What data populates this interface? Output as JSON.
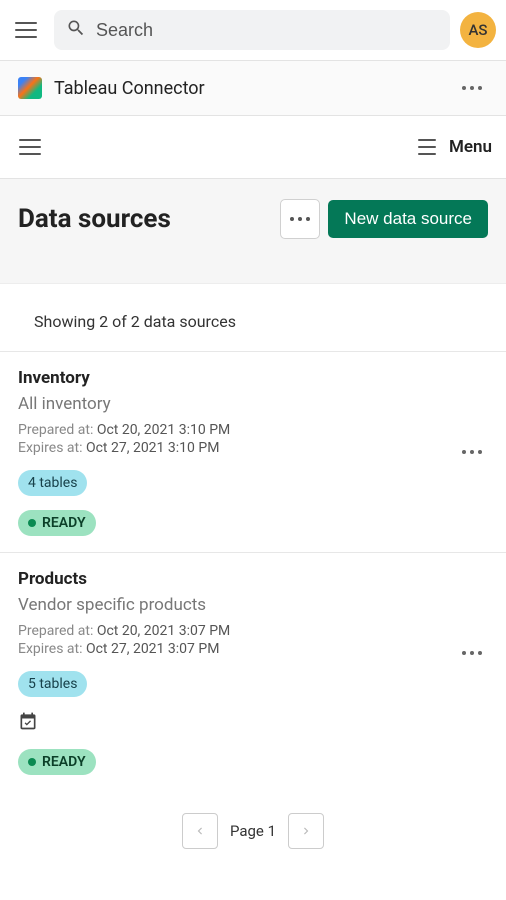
{
  "header": {
    "search_placeholder": "Search",
    "avatar_initials": "AS"
  },
  "app": {
    "title": "Tableau Connector",
    "menu_label": "Menu"
  },
  "page": {
    "title": "Data sources",
    "new_button": "New data source",
    "count_text": "Showing 2 of 2 data sources"
  },
  "items": [
    {
      "name": "Inventory",
      "description": "All inventory",
      "prepared_label": "Prepared at: ",
      "prepared_value": "Oct 20, 2021 3:10 PM",
      "expires_label": "Expires at: ",
      "expires_value": "Oct 27, 2021 3:10 PM",
      "tables": "4 tables",
      "status": "READY",
      "has_schedule_icon": false
    },
    {
      "name": "Products",
      "description": "Vendor specific products",
      "prepared_label": "Prepared at: ",
      "prepared_value": "Oct 20, 2021 3:07 PM",
      "expires_label": "Expires at: ",
      "expires_value": "Oct 27, 2021 3:07 PM",
      "tables": "5 tables",
      "status": "READY",
      "has_schedule_icon": true
    }
  ],
  "pagination": {
    "label": "Page 1"
  }
}
